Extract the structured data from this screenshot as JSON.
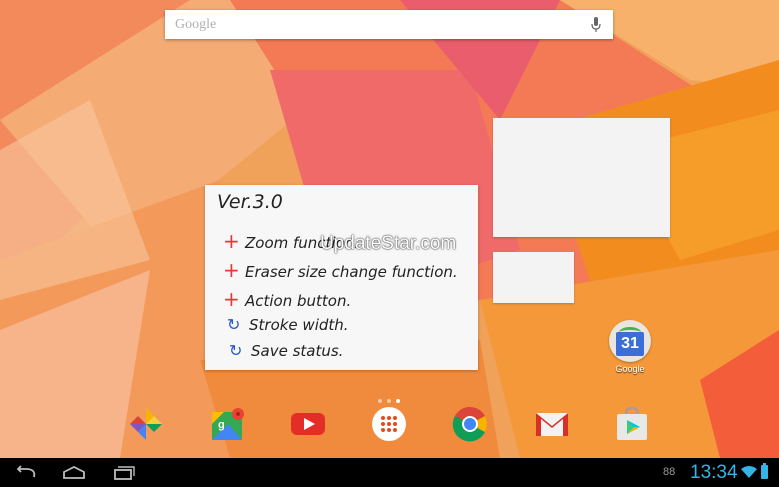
{
  "search": {
    "logo": "Google",
    "mic_icon": "mic-icon"
  },
  "note_widget": {
    "title": "Ver.3.0",
    "items": [
      {
        "mark": "+",
        "text": "Zoom function."
      },
      {
        "mark": "+",
        "text": "Eraser size change function."
      },
      {
        "mark": "+",
        "text": "Action button."
      },
      {
        "mark": "↻",
        "text": "Stroke width."
      },
      {
        "mark": "↻",
        "text": "Save status."
      }
    ]
  },
  "watermark": "UpdateStar.com",
  "calendar_app": {
    "day": "31",
    "label": "Google"
  },
  "dock": [
    {
      "name": "pinwheel-app-icon"
    },
    {
      "name": "maps-icon"
    },
    {
      "name": "youtube-icon"
    },
    {
      "name": "app-drawer-icon"
    },
    {
      "name": "chrome-icon"
    },
    {
      "name": "gmail-icon"
    },
    {
      "name": "play-store-icon"
    }
  ],
  "status": {
    "notification_count": "88",
    "time": "13:34"
  },
  "colors": {
    "accent": "#33b5e5",
    "plus_mark": "#ee3333",
    "cycle_mark": "#2a57c9"
  }
}
